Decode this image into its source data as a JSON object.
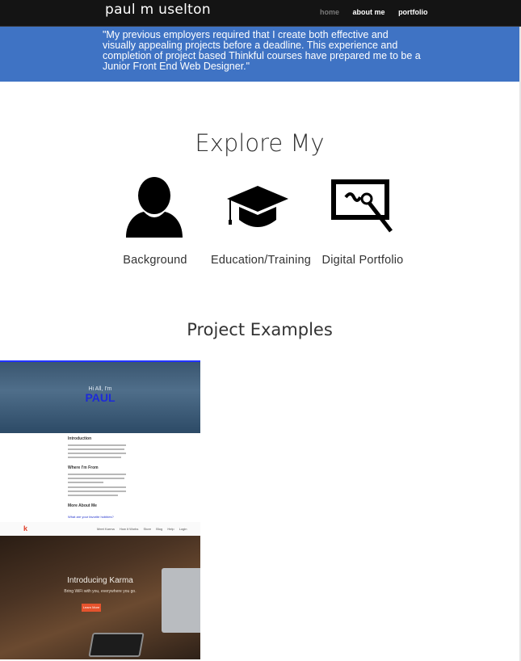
{
  "header": {
    "brand": "paul m uselton",
    "nav": [
      {
        "label": "home",
        "active": false
      },
      {
        "label": "about me",
        "active": true
      },
      {
        "label": "portfolio",
        "active": true
      }
    ]
  },
  "quote": "\"My previous employers required that I create both effective and visually appealing projects before a deadline. This experience and completion of project based Thinkful courses have prepared me to be a Junior Front End Web Designer.\"",
  "explore": {
    "title": "Explore My",
    "items": [
      {
        "label": "Background",
        "icon": "person-icon"
      },
      {
        "label": "Education/Training",
        "icon": "graduation-cap-icon"
      },
      {
        "label": "Digital Portfolio",
        "icon": "drawing-tablet-icon"
      }
    ]
  },
  "projects": {
    "title": "Project Examples",
    "thumb1": {
      "greeting": "Hi All, I'm",
      "name": "PAUL",
      "headings": [
        "Introduction",
        "Where I'm From",
        "More About Me"
      ],
      "link": "What are your favorite hobbies?"
    },
    "thumb2": {
      "logo": "k",
      "links": [
        "Meet Karma",
        "How it Works",
        "Store",
        "Blog",
        "Help",
        "Login"
      ],
      "title": "Introducing Karma",
      "subtitle": "Bring WiFi with you, everywhere you go.",
      "button": "Learn More"
    }
  },
  "colors": {
    "banner": "#3f73c4",
    "topbar": "#141414"
  }
}
